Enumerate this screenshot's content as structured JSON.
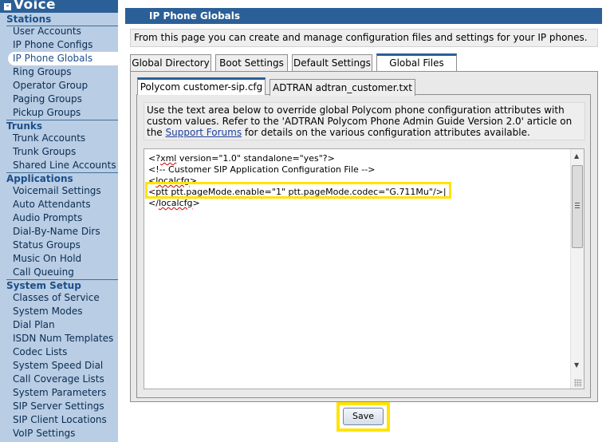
{
  "sidebar": {
    "title": "Voice",
    "toggle": "-",
    "sections": [
      {
        "label": "Stations",
        "items": [
          "User Accounts",
          "IP Phone Configs",
          "IP Phone Globals",
          "Ring Groups",
          "Operator Group",
          "Paging Groups",
          "Pickup Groups"
        ]
      },
      {
        "label": "Trunks",
        "items": [
          "Trunk Accounts",
          "Trunk Groups",
          "Shared Line Accounts"
        ]
      },
      {
        "label": "Applications",
        "items": [
          "Voicemail Settings",
          "Auto Attendants",
          "Audio Prompts",
          "Dial-By-Name Dirs",
          "Status Groups",
          "Music On Hold",
          "Call Queuing"
        ]
      },
      {
        "label": "System Setup",
        "items": [
          "Classes of Service",
          "System Modes",
          "Dial Plan",
          "ISDN Num Templates",
          "Codec Lists",
          "System Speed Dial",
          "Call Coverage Lists",
          "System Parameters",
          "SIP Server Settings",
          "SIP Client Locations",
          "VoIP Settings"
        ]
      }
    ],
    "active_item": "IP Phone Globals"
  },
  "main": {
    "title": "IP Phone Globals",
    "intro": "From this page you can create and manage configuration files and settings for your IP phones.",
    "tabs": [
      {
        "label": "Global Directory",
        "active": false
      },
      {
        "label": "Boot Settings",
        "active": false
      },
      {
        "label": "Default Settings",
        "active": false
      },
      {
        "label": "Global Files",
        "active": true
      }
    ],
    "subtabs": [
      {
        "label": "Polycom customer-sip.cfg",
        "active": true
      },
      {
        "label": "ADTRAN adtran_customer.txt",
        "active": false
      }
    ],
    "description": {
      "text_before": "Use the text area below to override global Polycom phone configuration attributes with custom values. Refer to the 'ADTRAN Polycom Phone Admin Guide Version 2.0' article on the ",
      "link": "Support Forums",
      "text_after": " for details on the various configuration attributes available."
    },
    "editor": {
      "lines": [
        "<?xml version=\"1.0\" standalone=\"yes\"?>",
        "<!-- Customer SIP Application Configuration File -->",
        "<localcfg>",
        "<ptt ptt.pageMode.enable=\"1\" ptt.pageMode.codec=\"G.711Mu\"/>",
        "</localcfg>"
      ]
    },
    "save_label": "Save"
  },
  "colors": {
    "header_blue": "#2b5f97",
    "sidebar_bg": "#b9cde4",
    "highlight_yellow": "#ffe400"
  }
}
